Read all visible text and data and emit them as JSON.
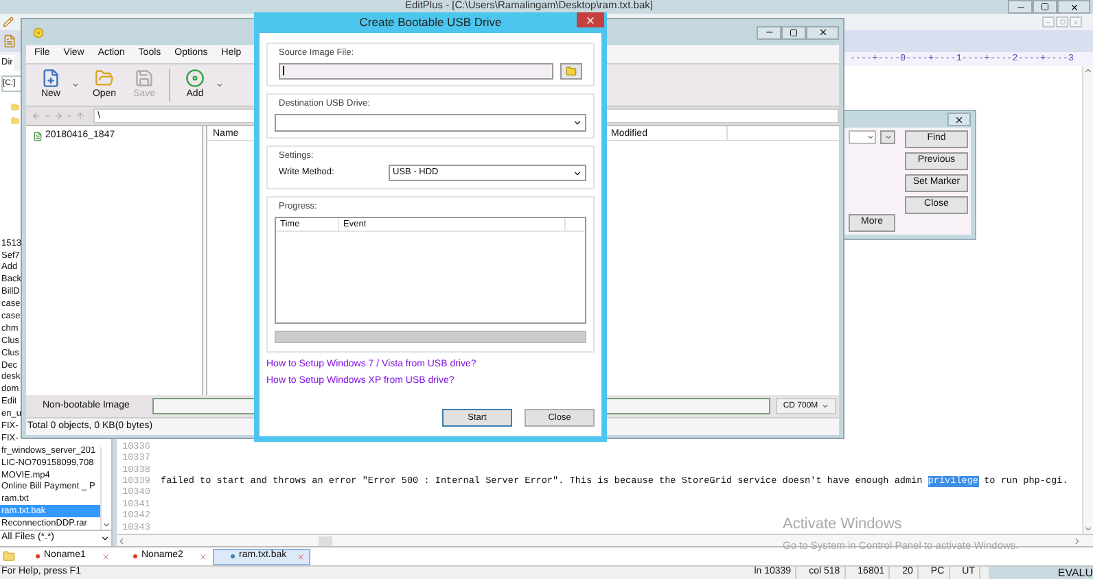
{
  "editplus": {
    "title": "EditPlus - [C:\\Users\\Ramalingam\\Desktop\\ram.txt.bak]",
    "ruler": "----+----0----+----1----+----2----+----3",
    "dir_tab": "Dir",
    "drive": "[C:]",
    "files": [
      {
        "name": "1513",
        "selected": false
      },
      {
        "name": "Sef7",
        "selected": false
      },
      {
        "name": "Add",
        "selected": false
      },
      {
        "name": "Back",
        "selected": false
      },
      {
        "name": "BillD",
        "selected": false
      },
      {
        "name": "case",
        "selected": false
      },
      {
        "name": "case",
        "selected": false
      },
      {
        "name": "chm",
        "selected": false
      },
      {
        "name": "Clus",
        "selected": false
      },
      {
        "name": "Clus",
        "selected": false
      },
      {
        "name": "Dec",
        "selected": false
      },
      {
        "name": "desk",
        "selected": false
      },
      {
        "name": "dom",
        "selected": false
      },
      {
        "name": "Edit",
        "selected": false
      },
      {
        "name": "en_u",
        "selected": false
      },
      {
        "name": "FIX-",
        "selected": false
      },
      {
        "name": "FIX-",
        "selected": false
      },
      {
        "name": "fr_windows_server_201",
        "selected": false
      },
      {
        "name": "LIC-NO709158099,708",
        "selected": false
      },
      {
        "name": "MOVIE.mp4",
        "selected": false
      },
      {
        "name": "Online Bill Payment _ P",
        "selected": false
      },
      {
        "name": "ram.txt",
        "selected": false
      },
      {
        "name": "ram.txt.bak",
        "selected": true
      },
      {
        "name": "ReconnectionDDP.rar",
        "selected": false
      }
    ],
    "filter": "All Files (*.*)",
    "lines": [
      {
        "number": "10336"
      },
      {
        "number": "10337"
      },
      {
        "number": "10338"
      },
      {
        "number": "10339",
        "segments": [
          {
            "text": "failed to start and throws an error \"Error 500 : Internal Server Error\". This is because the StoreGrid service doesn't have enough admin ",
            "selected": false
          },
          {
            "text": "privilege",
            "selected": true
          },
          {
            "text": " to run php-cgi.",
            "selected": false
          }
        ]
      },
      {
        "number": "10340"
      },
      {
        "number": "10341"
      },
      {
        "number": "10342"
      },
      {
        "number": "10343"
      }
    ],
    "find_dialog": {
      "buttons": [
        {
          "label": "Find"
        },
        {
          "label": "Previous"
        },
        {
          "label": "Set Marker"
        },
        {
          "label": "Close"
        }
      ],
      "more_button": "More"
    },
    "tabs": [
      {
        "label": "Noname1",
        "selected": false,
        "color": "#d83a2a"
      },
      {
        "label": "Noname2",
        "selected": false,
        "color": "#d83a2a"
      },
      {
        "label": "ram.txt.bak",
        "selected": true,
        "color": "#3a7fb0"
      }
    ],
    "status_bar": {
      "help": "For Help, press F1",
      "fields": [
        "ln 10339",
        "col 518",
        "16801",
        "20",
        "PC",
        "UT"
      ],
      "badge": "EVALU"
    }
  },
  "archive": {
    "menu": [
      "File",
      "View",
      "Action",
      "Tools",
      "Options",
      "Help"
    ],
    "toolbar": [
      {
        "kind": "new",
        "label": "New",
        "disabled": false,
        "has_menu": true
      },
      {
        "kind": "open",
        "label": "Open",
        "disabled": false,
        "has_menu": false
      },
      {
        "kind": "save",
        "label": "Save",
        "disabled": true,
        "has_menu": false
      },
      {
        "kind": "add",
        "label": "Add",
        "disabled": false,
        "has_menu": true
      }
    ],
    "path": "\\",
    "tree": [
      "20180416_1847"
    ],
    "columns": [
      "Name",
      "Modified"
    ],
    "image_type": "Non-bootable Image",
    "capacity": "CD 700M",
    "status": "Total 0 objects, 0 KB(0 bytes)"
  },
  "usb_dialog": {
    "title": "Create Bootable USB Drive",
    "source_label": "Source Image File:",
    "destination_label": "Destination USB Drive:",
    "settings_label": "Settings:",
    "write_method_label": "Write Method:",
    "write_method": "USB - HDD",
    "progress_label": "Progress:",
    "columns": [
      "Time",
      "Event"
    ],
    "level": 0,
    "links": [
      "How to Setup Windows 7 / Vista from USB drive?",
      "How to Setup Windows XP from USB drive?"
    ],
    "buttons": [
      "Start",
      "Close"
    ]
  },
  "activation": {
    "title": "Activate Windows",
    "text": "Go to System in Control Panel to activate Windows."
  }
}
